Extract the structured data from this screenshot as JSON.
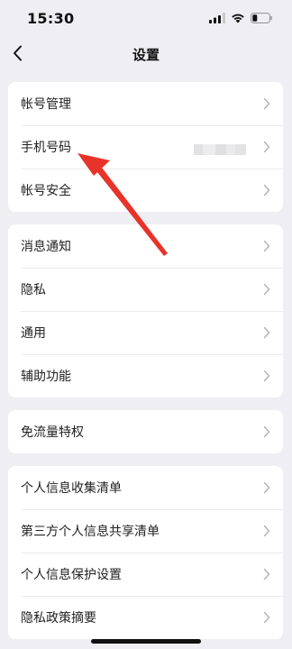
{
  "status_bar": {
    "time": "15:30"
  },
  "header": {
    "title": "设置"
  },
  "groups": [
    {
      "items": [
        {
          "label": "帐号管理"
        },
        {
          "label": "手机号码"
        },
        {
          "label": "帐号安全"
        }
      ]
    },
    {
      "items": [
        {
          "label": "消息通知"
        },
        {
          "label": "隐私"
        },
        {
          "label": "通用"
        },
        {
          "label": "辅助功能"
        }
      ]
    },
    {
      "items": [
        {
          "label": "免流量特权"
        }
      ]
    },
    {
      "items": [
        {
          "label": "个人信息收集清单"
        },
        {
          "label": "第三方个人信息共享清单"
        },
        {
          "label": "个人信息保护设置"
        },
        {
          "label": "隐私政策摘要"
        }
      ]
    }
  ],
  "colors": {
    "annotation_arrow": "#e8332a",
    "background": "#efeff3",
    "card": "#ffffff"
  },
  "icons": {
    "back": "chevron-left-icon",
    "row": "chevron-right-icon",
    "signal": "cellular-signal-icon",
    "wifi": "wifi-icon",
    "battery": "battery-icon"
  }
}
